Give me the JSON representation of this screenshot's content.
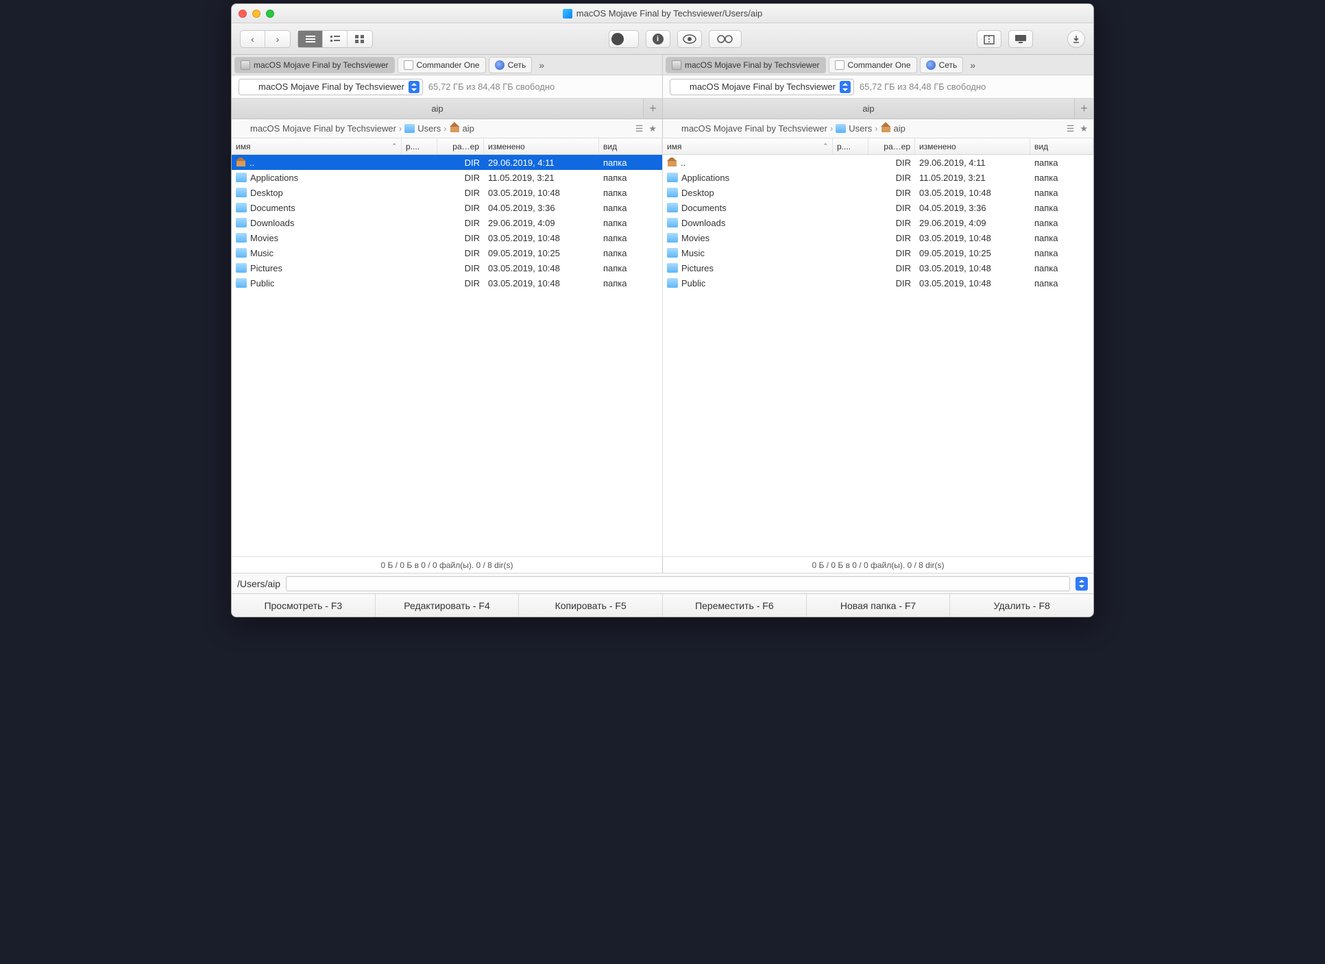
{
  "window": {
    "title": "macOS Mojave Final by Techsviewer/Users/aip"
  },
  "drive": {
    "name": "macOS Mojave Final by Techsviewer",
    "free_space": "65,72 ГБ из 84,48 ГБ свободно"
  },
  "tabs": {
    "active": "macOS Mojave Final by Techsviewer",
    "second": "Commander One",
    "third": "Сеть"
  },
  "current_tab": "aip",
  "breadcrumb": {
    "root": "macOS Mojave Final by Techsviewer",
    "folder1": "Users",
    "folder2": "aip"
  },
  "columns": {
    "name": "имя",
    "ext": "р....",
    "size": "ра…ер",
    "modified": "изменено",
    "kind": "вид"
  },
  "rows": [
    {
      "icon": "home",
      "name": "..",
      "size": "DIR",
      "mod": "29.06.2019, 4:11",
      "kind": "папка"
    },
    {
      "icon": "folder",
      "name": "Applications",
      "size": "DIR",
      "mod": "11.05.2019, 3:21",
      "kind": "папка"
    },
    {
      "icon": "folder",
      "name": "Desktop",
      "size": "DIR",
      "mod": "03.05.2019, 10:48",
      "kind": "папка"
    },
    {
      "icon": "folder",
      "name": "Documents",
      "size": "DIR",
      "mod": "04.05.2019, 3:36",
      "kind": "папка"
    },
    {
      "icon": "folder",
      "name": "Downloads",
      "size": "DIR",
      "mod": "29.06.2019, 4:09",
      "kind": "папка"
    },
    {
      "icon": "folder",
      "name": "Movies",
      "size": "DIR",
      "mod": "03.05.2019, 10:48",
      "kind": "папка"
    },
    {
      "icon": "folder",
      "name": "Music",
      "size": "DIR",
      "mod": "09.05.2019, 10:25",
      "kind": "папка"
    },
    {
      "icon": "folder",
      "name": "Pictures",
      "size": "DIR",
      "mod": "03.05.2019, 10:48",
      "kind": "папка"
    },
    {
      "icon": "folder",
      "name": "Public",
      "size": "DIR",
      "mod": "03.05.2019, 10:48",
      "kind": "папка"
    }
  ],
  "status_line": "0 Б / 0 Б в 0 / 0 файл(ы). 0 / 8 dir(s)",
  "path_input": "/Users/aip",
  "fkeys": {
    "f3": "Просмотреть - F3",
    "f4": "Редактировать - F4",
    "f5": "Копировать - F5",
    "f6": "Переместить - F6",
    "f7": "Новая папка - F7",
    "f8": "Удалить - F8"
  }
}
